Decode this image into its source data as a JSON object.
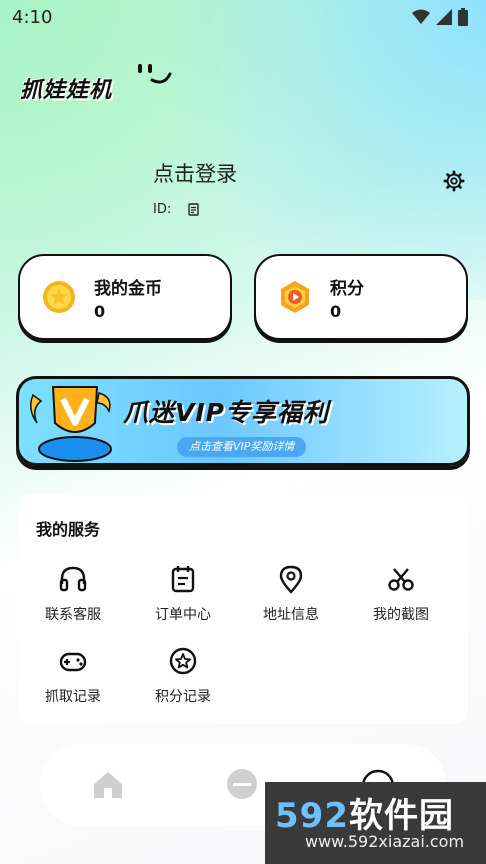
{
  "status": {
    "time": "4:10"
  },
  "app": {
    "brand": "抓娃娃机"
  },
  "profile": {
    "login_label": "点击登录",
    "id_label": "ID:"
  },
  "cards": [
    {
      "title": "我的金币",
      "value": "0"
    },
    {
      "title": "积分",
      "value": "0"
    }
  ],
  "vip": {
    "title": "爪迷VIP专享福利",
    "subtitle": "点击查看VIP奖励详情"
  },
  "services": {
    "title": "我的服务",
    "items": [
      {
        "label": "联系客服",
        "icon": "headset-icon"
      },
      {
        "label": "订单中心",
        "icon": "order-icon"
      },
      {
        "label": "地址信息",
        "icon": "location-icon"
      },
      {
        "label": "我的截图",
        "icon": "scissors-icon"
      },
      {
        "label": "抓取记录",
        "icon": "gamepad-icon"
      },
      {
        "label": "积分记录",
        "icon": "star-icon"
      }
    ]
  },
  "watermark": {
    "brand_num": "592",
    "brand_text": "软件园",
    "url": "www.592xiazai.com"
  }
}
